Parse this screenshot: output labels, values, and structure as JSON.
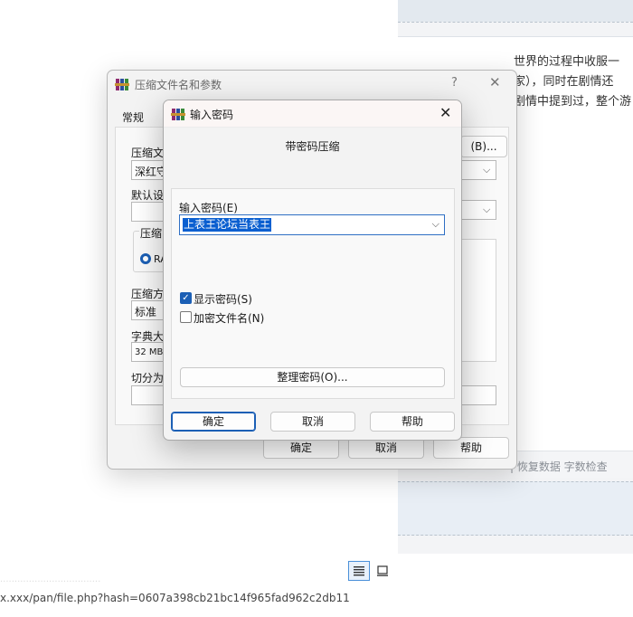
{
  "background": {
    "editor_lines": [
      "世界的过程中收服一",
      "家），同时在剧情还",
      "剧情中提到过，整个游"
    ],
    "status_text": "| 恢复数据   字数检查",
    "url": "x.xxx/pan/file.php?hash=0607a398cb21bc14f965fad962c2db11",
    "blurred_line": "···································"
  },
  "back_dialog": {
    "title": "压缩文件名和参数",
    "help": "?",
    "close": "✕",
    "tab_general": "常规",
    "archive_name_label": "压缩文",
    "archive_name_value": "深红守",
    "browse_button": "(B)...",
    "default_profile_label": "默认设",
    "format_group_label": "压缩",
    "format_radio_label": "RA",
    "method_label": "压缩方",
    "method_value": "标准",
    "dict_label": "字典大",
    "dict_value": "32 MB",
    "split_label": "切分为",
    "ok": "确定",
    "cancel": "取消",
    "help_button": "帮助"
  },
  "front_dialog": {
    "title": "输入密码",
    "close": "✕",
    "heading": "带密码压缩",
    "password_label": "输入密码(E)",
    "password_value": "上表王论坛当表王",
    "show_password": {
      "label": "显示密码(S)",
      "checked": true
    },
    "encrypt_names": {
      "label": "加密文件名(N)",
      "checked": false
    },
    "organize_button": "整理密码(O)...",
    "ok": "确定",
    "cancel": "取消",
    "help": "帮助"
  },
  "colors": {
    "accent": "#1b5fb5",
    "selection": "#0a5fd0"
  },
  "icons": [
    "winrar-icon",
    "close-icon",
    "help-icon",
    "chevron-down-icon",
    "list-view-icon",
    "page-view-icon"
  ]
}
